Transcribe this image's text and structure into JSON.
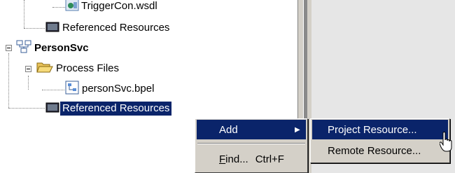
{
  "tree": {
    "items": [
      {
        "label": "TriggerCon.wsdl"
      },
      {
        "label": "Referenced Resources"
      },
      {
        "label": "PersonSvc"
      },
      {
        "label": "Process Files"
      },
      {
        "label": "personSvc.bpel"
      },
      {
        "label": "Referenced Resources"
      }
    ]
  },
  "context_menu": {
    "add_label": "Add",
    "submenu_arrow": "▶",
    "find_label_mnemonic": "F",
    "find_label_rest": "ind...",
    "find_shortcut": "Ctrl+F"
  },
  "submenu": {
    "items": [
      "Project Resource...",
      "Remote Resource..."
    ]
  },
  "icons": [
    "wsdl-file-icon",
    "folder-icon",
    "project-icon",
    "open-folder-icon",
    "bpel-file-icon",
    "mouse-cursor-icon"
  ],
  "colors": {
    "selection": "#0a246a",
    "menu_bg": "#d4d0c8",
    "workspace": "#e6e6e6"
  }
}
